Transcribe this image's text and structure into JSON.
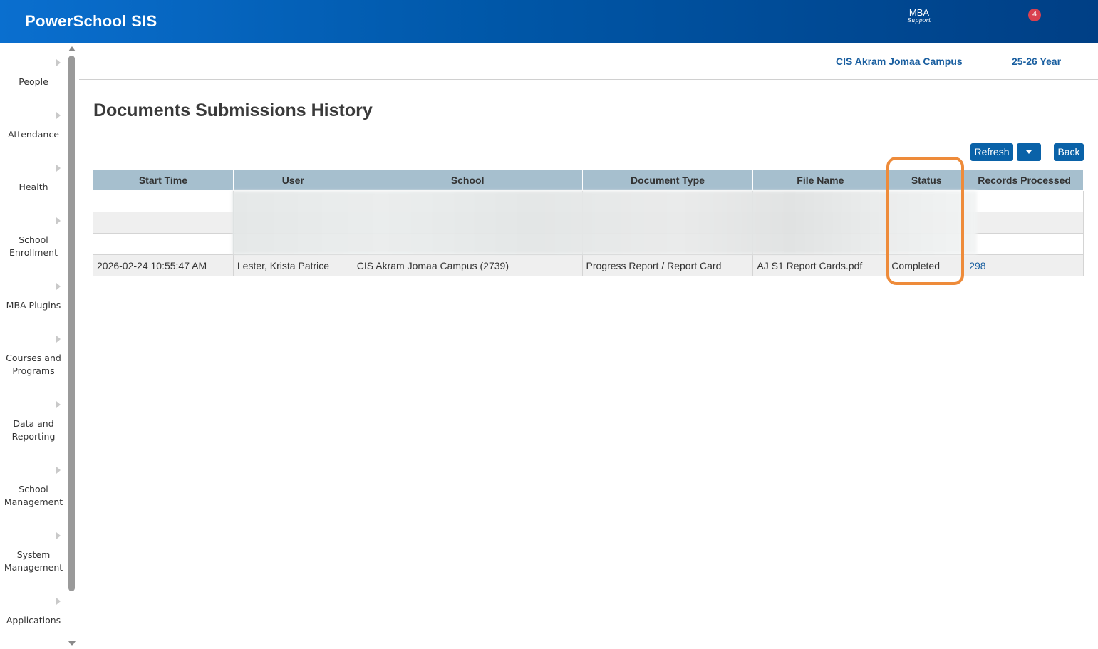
{
  "header": {
    "brand": "PowerSchool SIS",
    "logo_line1": "MBA",
    "logo_line2": "Support",
    "notification_count": "4"
  },
  "context": {
    "school": "CIS Akram Jomaa Campus",
    "term": "25-26 Year"
  },
  "sidebar": {
    "items": [
      {
        "label": "People"
      },
      {
        "label": "Attendance"
      },
      {
        "label": "Health"
      },
      {
        "label": "School Enrollment"
      },
      {
        "label": "MBA Plugins"
      },
      {
        "label": "Courses and Programs"
      },
      {
        "label": "Data and Reporting"
      },
      {
        "label": "School Management"
      },
      {
        "label": "System Management"
      },
      {
        "label": "Applications"
      }
    ]
  },
  "page": {
    "title": "Documents Submissions History",
    "refresh_label": "Refresh",
    "back_label": "Back"
  },
  "table": {
    "columns": [
      "Start Time",
      "User",
      "School",
      "Document Type",
      "File Name",
      "Status",
      "Records Processed"
    ],
    "rows": [
      {
        "start_time": "2026-02-24 10:55:47 AM",
        "user": "Lester, Krista Patrice",
        "school": "CIS Akram Jomaa Campus (2739)",
        "document_type": "Progress Report / Report Card",
        "file_name": "AJ S1 Report Cards.pdf",
        "status": "Completed",
        "records_processed": "298"
      }
    ]
  },
  "colors": {
    "header_gradient_start": "#0a6fcf",
    "header_gradient_end": "#003f85",
    "accent": "#0a62a8",
    "table_header": "#a6bfce",
    "highlight": "#ee8b3a"
  }
}
